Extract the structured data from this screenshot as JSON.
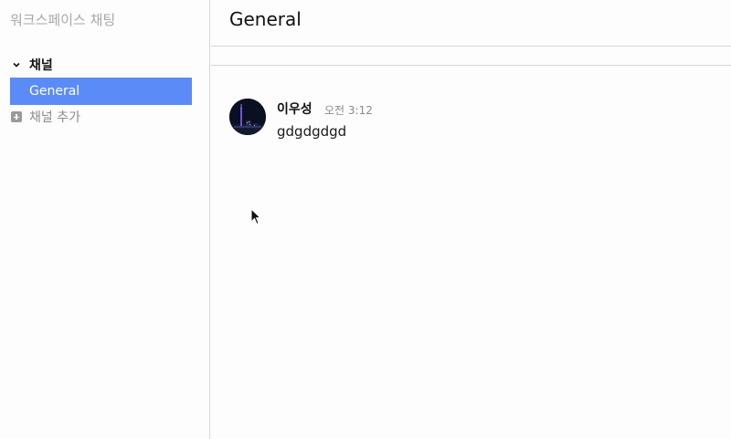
{
  "sidebar": {
    "workspace_title": "워크스페이스 채팅",
    "section_label": "채널",
    "channels": [
      {
        "label": "General",
        "selected": true
      }
    ],
    "add_channel_label": "채널 추가"
  },
  "channel": {
    "title": "General"
  },
  "messages": [
    {
      "author": "이우성",
      "time": "오전 3:12",
      "text": "gdgdgdgd"
    }
  ],
  "colors": {
    "accent": "#5b8bf7",
    "muted_text": "#a8a8a8",
    "divider": "#d6d6d6"
  }
}
